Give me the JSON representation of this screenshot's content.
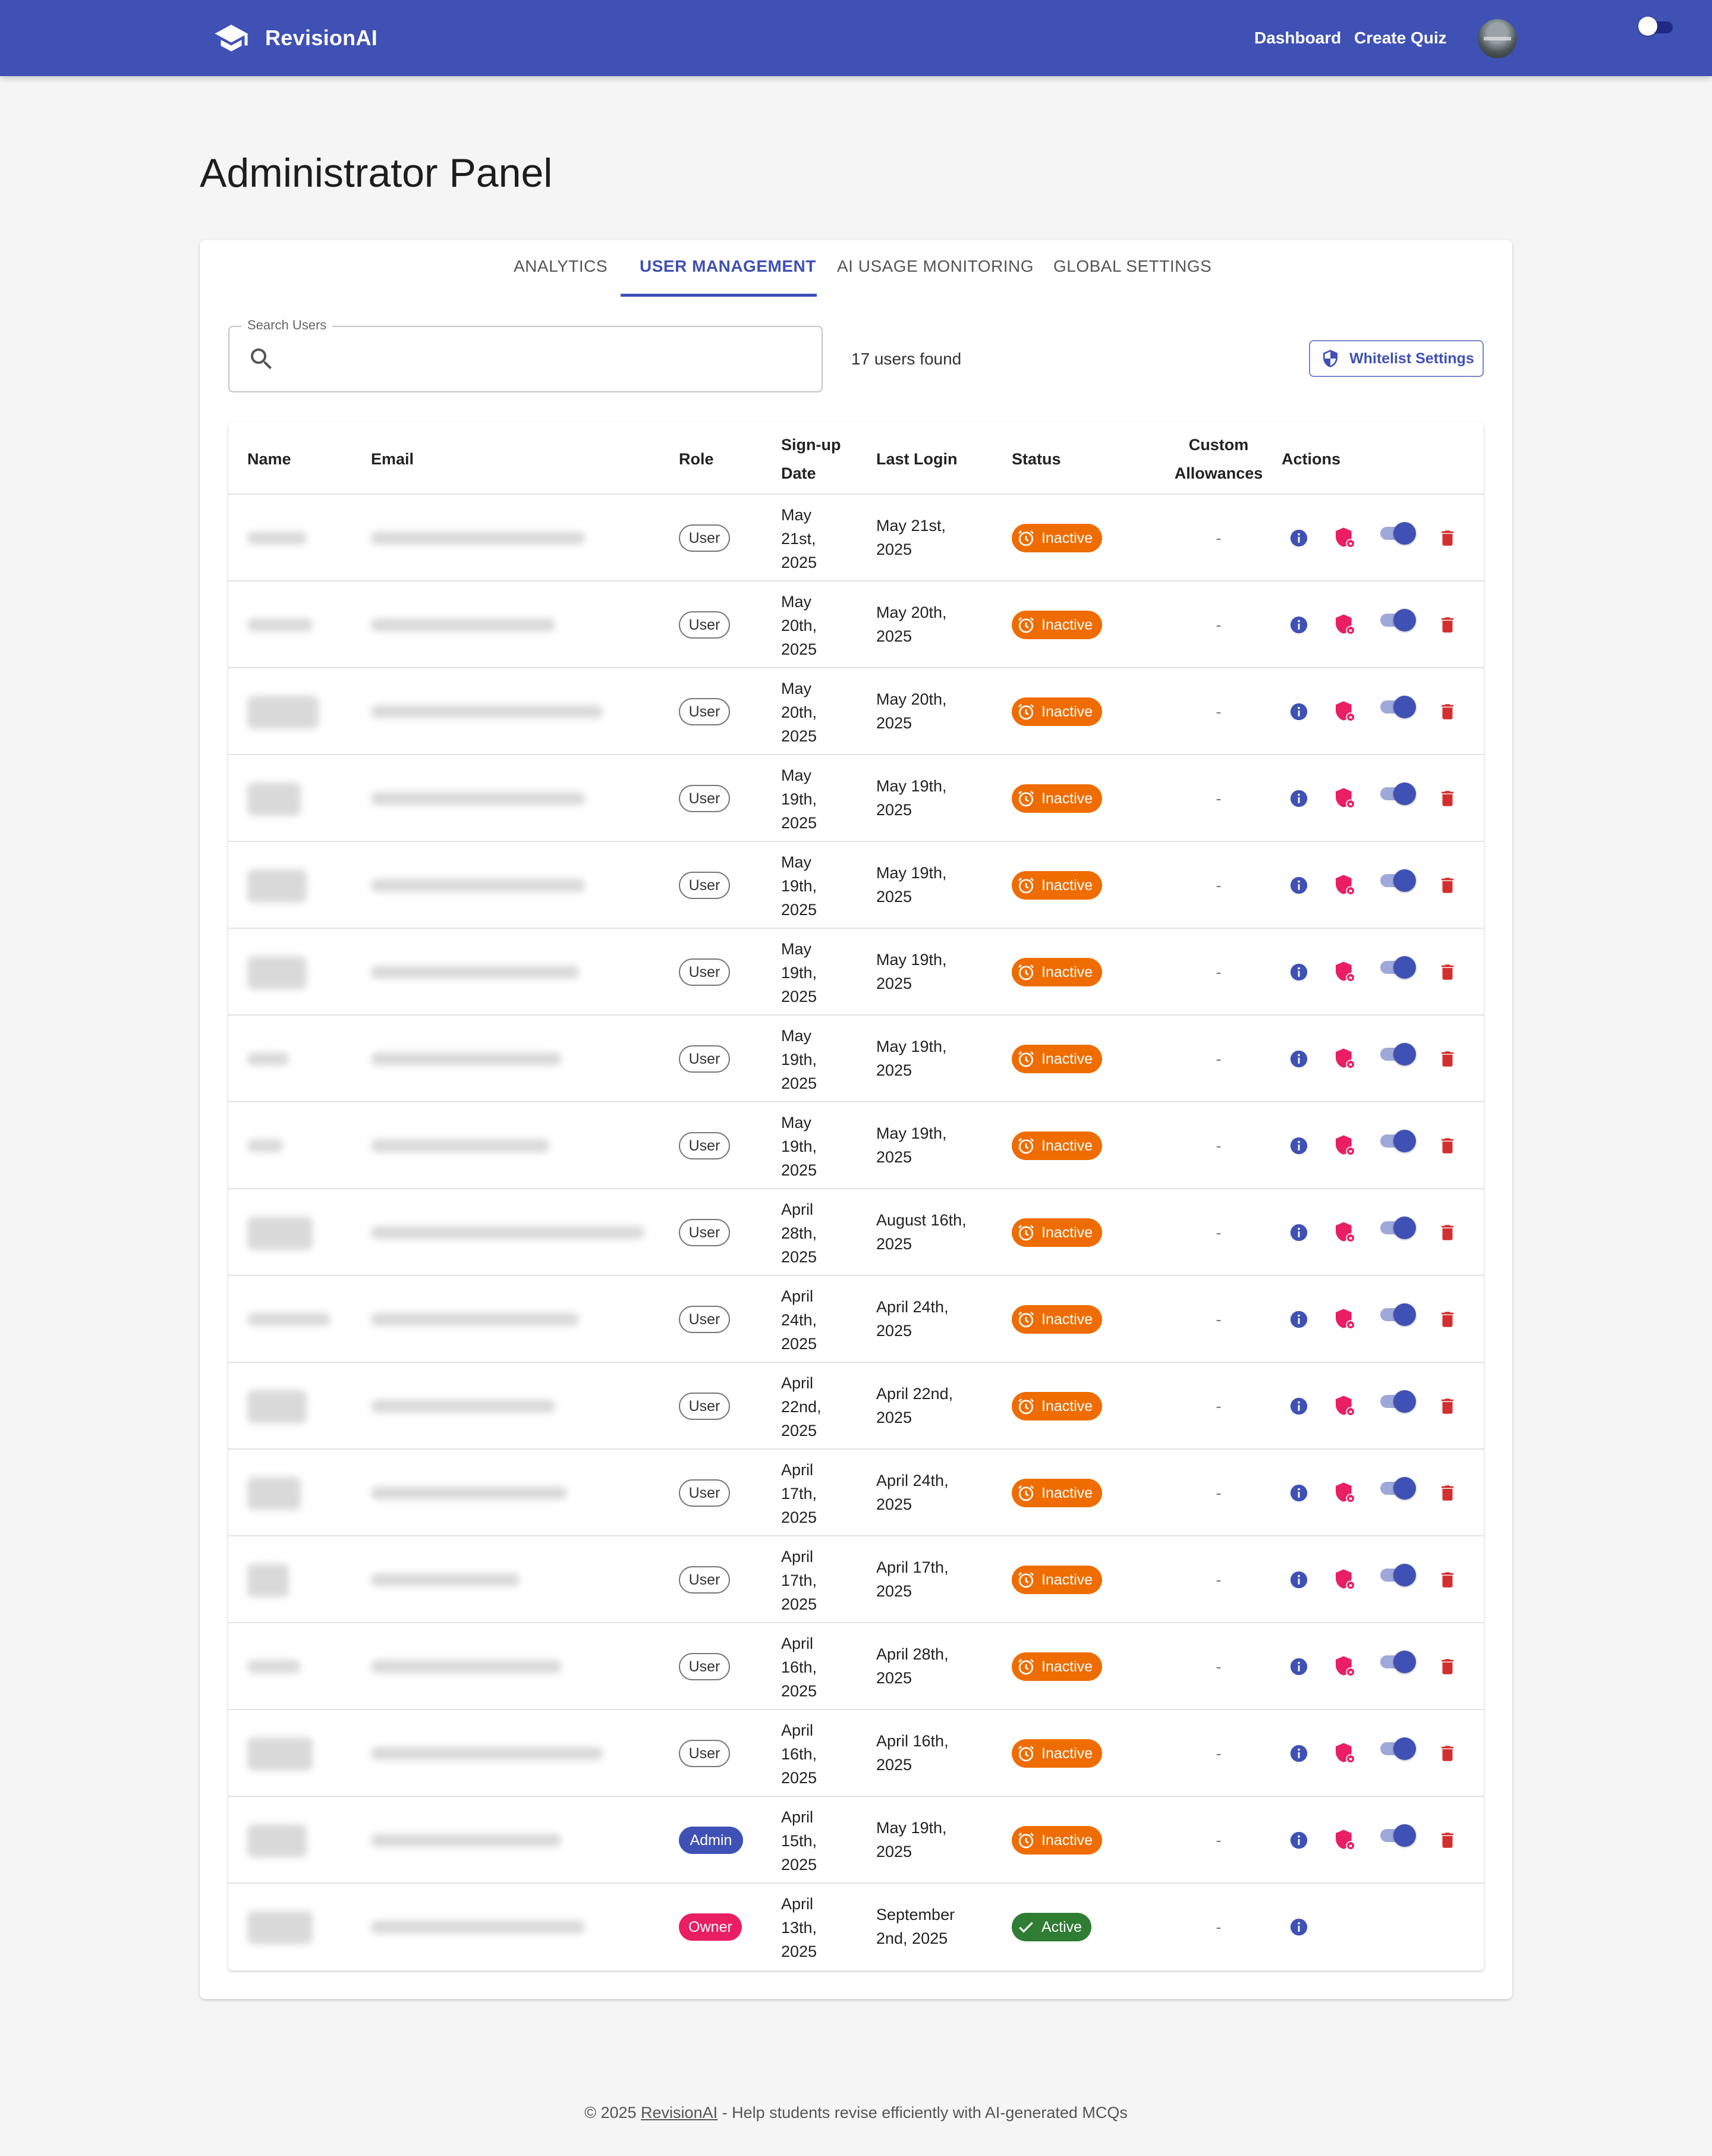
{
  "app": {
    "name": "RevisionAI"
  },
  "nav": {
    "dashboard": "Dashboard",
    "create_quiz": "Create Quiz"
  },
  "page_title": "Administrator Panel",
  "tabs": [
    {
      "label": "ANALYTICS",
      "active": false
    },
    {
      "label": "USER MANAGEMENT",
      "active": true
    },
    {
      "label": "AI USAGE MONITORING",
      "active": false
    },
    {
      "label": "GLOBAL SETTINGS",
      "active": false
    }
  ],
  "search": {
    "label": "Search Users",
    "value": "",
    "placeholder": ""
  },
  "users_found": "17 users found",
  "whitelist_button": "Whitelist Settings",
  "table": {
    "headers": {
      "name": "Name",
      "email": "Email",
      "role": "Role",
      "signup_line1": "Sign-up",
      "signup_line2": "Date",
      "last_login": "Last Login",
      "status": "Status",
      "custom_line1": "Custom",
      "custom_line2": "Allowances",
      "actions": "Actions"
    },
    "rows": [
      {
        "role": "User",
        "signup": [
          "May",
          "21st,",
          "2025"
        ],
        "last_login": [
          "May 21st,",
          "2025"
        ],
        "status": "Inactive",
        "allowance": "-",
        "actions": true
      },
      {
        "role": "User",
        "signup": [
          "May",
          "20th,",
          "2025"
        ],
        "last_login": [
          "May 20th,",
          "2025"
        ],
        "status": "Inactive",
        "allowance": "-",
        "actions": true
      },
      {
        "role": "User",
        "signup": [
          "May",
          "20th,",
          "2025"
        ],
        "last_login": [
          "May 20th,",
          "2025"
        ],
        "status": "Inactive",
        "allowance": "-",
        "actions": true
      },
      {
        "role": "User",
        "signup": [
          "May",
          "19th,",
          "2025"
        ],
        "last_login": [
          "May 19th,",
          "2025"
        ],
        "status": "Inactive",
        "allowance": "-",
        "actions": true
      },
      {
        "role": "User",
        "signup": [
          "May",
          "19th,",
          "2025"
        ],
        "last_login": [
          "May 19th,",
          "2025"
        ],
        "status": "Inactive",
        "allowance": "-",
        "actions": true
      },
      {
        "role": "User",
        "signup": [
          "May",
          "19th,",
          "2025"
        ],
        "last_login": [
          "May 19th,",
          "2025"
        ],
        "status": "Inactive",
        "allowance": "-",
        "actions": true
      },
      {
        "role": "User",
        "signup": [
          "May",
          "19th,",
          "2025"
        ],
        "last_login": [
          "May 19th,",
          "2025"
        ],
        "status": "Inactive",
        "allowance": "-",
        "actions": true
      },
      {
        "role": "User",
        "signup": [
          "May",
          "19th,",
          "2025"
        ],
        "last_login": [
          "May 19th,",
          "2025"
        ],
        "status": "Inactive",
        "allowance": "-",
        "actions": true
      },
      {
        "role": "User",
        "signup": [
          "April",
          "28th,",
          "2025"
        ],
        "last_login": [
          "August 16th,",
          "2025"
        ],
        "status": "Inactive",
        "allowance": "-",
        "actions": true
      },
      {
        "role": "User",
        "signup": [
          "April",
          "24th,",
          "2025"
        ],
        "last_login": [
          "April 24th,",
          "2025"
        ],
        "status": "Inactive",
        "allowance": "-",
        "actions": true
      },
      {
        "role": "User",
        "signup": [
          "April",
          "22nd,",
          "2025"
        ],
        "last_login": [
          "April 22nd,",
          "2025"
        ],
        "status": "Inactive",
        "allowance": "-",
        "actions": true
      },
      {
        "role": "User",
        "signup": [
          "April",
          "17th,",
          "2025"
        ],
        "last_login": [
          "April 24th,",
          "2025"
        ],
        "status": "Inactive",
        "allowance": "-",
        "actions": true
      },
      {
        "role": "User",
        "signup": [
          "April",
          "17th,",
          "2025"
        ],
        "last_login": [
          "April 17th,",
          "2025"
        ],
        "status": "Inactive",
        "allowance": "-",
        "actions": true
      },
      {
        "role": "User",
        "signup": [
          "April",
          "16th,",
          "2025"
        ],
        "last_login": [
          "April 28th,",
          "2025"
        ],
        "status": "Inactive",
        "allowance": "-",
        "actions": true
      },
      {
        "role": "User",
        "signup": [
          "April",
          "16th,",
          "2025"
        ],
        "last_login": [
          "April 16th,",
          "2025"
        ],
        "status": "Inactive",
        "allowance": "-",
        "actions": true
      },
      {
        "role": "Admin",
        "signup": [
          "April",
          "15th,",
          "2025"
        ],
        "last_login": [
          "May 19th,",
          "2025"
        ],
        "status": "Inactive",
        "allowance": "-",
        "actions": true
      },
      {
        "role": "Owner",
        "signup": [
          "April",
          "13th,",
          "2025"
        ],
        "last_login": [
          "September",
          "2nd, 2025"
        ],
        "status": "Active",
        "allowance": "-",
        "actions": false
      }
    ]
  },
  "footer": {
    "prefix": "© 2025 ",
    "link": "RevisionAI",
    "suffix": " - Help students revise efficiently with AI-generated MCQs"
  },
  "colors": {
    "primary": "#3f51b5",
    "inactive": "#ef6c00",
    "active": "#2e7d32",
    "owner": "#e91e63",
    "delete": "#d32f2f"
  }
}
